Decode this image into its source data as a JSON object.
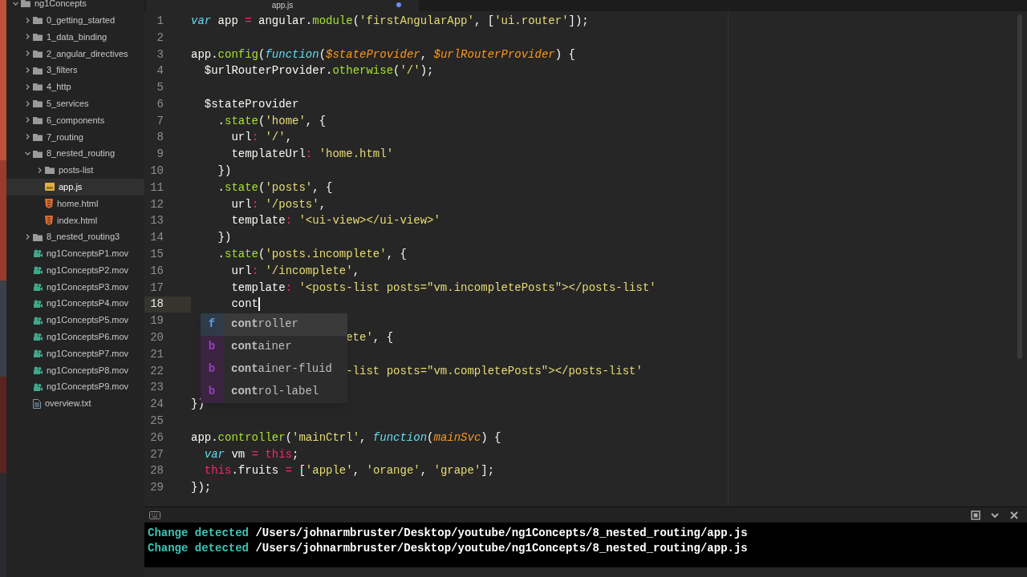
{
  "sidebar": {
    "tree": [
      {
        "label": "ng1Concepts",
        "kind": "folder",
        "expanded": true,
        "selected": false,
        "children": [
          {
            "label": "0_getting_started",
            "kind": "folder",
            "expanded": false,
            "selected": false
          },
          {
            "label": "1_data_binding",
            "kind": "folder",
            "expanded": false,
            "selected": false
          },
          {
            "label": "2_angular_directives",
            "kind": "folder",
            "expanded": false,
            "selected": false
          },
          {
            "label": "3_filters",
            "kind": "folder",
            "expanded": false,
            "selected": false
          },
          {
            "label": "4_http",
            "kind": "folder",
            "expanded": false,
            "selected": false
          },
          {
            "label": "5_services",
            "kind": "folder",
            "expanded": false,
            "selected": false
          },
          {
            "label": "6_components",
            "kind": "folder",
            "expanded": false,
            "selected": false
          },
          {
            "label": "7_routing",
            "kind": "folder",
            "expanded": false,
            "selected": false
          },
          {
            "label": "8_nested_routing",
            "kind": "folder",
            "expanded": true,
            "selected": false,
            "children": [
              {
                "label": "posts-list",
                "kind": "folder",
                "expanded": false,
                "selected": false
              },
              {
                "label": "app.js",
                "kind": "js",
                "selected": true
              },
              {
                "label": "home.html",
                "kind": "html",
                "selected": false
              },
              {
                "label": "index.html",
                "kind": "html",
                "selected": false
              }
            ]
          },
          {
            "label": "8_nested_routing3",
            "kind": "folder",
            "expanded": false,
            "selected": false
          },
          {
            "label": "ng1ConceptsP1.mov",
            "kind": "video",
            "selected": false
          },
          {
            "label": "ng1ConceptsP2.mov",
            "kind": "video",
            "selected": false
          },
          {
            "label": "ng1ConceptsP3.mov",
            "kind": "video",
            "selected": false
          },
          {
            "label": "ng1ConceptsP4.mov",
            "kind": "video",
            "selected": false
          },
          {
            "label": "ng1ConceptsP5.mov",
            "kind": "video",
            "selected": false
          },
          {
            "label": "ng1ConceptsP6.mov",
            "kind": "video",
            "selected": false
          },
          {
            "label": "ng1ConceptsP7.mov",
            "kind": "video",
            "selected": false
          },
          {
            "label": "ng1ConceptsP8.mov",
            "kind": "video",
            "selected": false
          },
          {
            "label": "ng1ConceptsP9.mov",
            "kind": "video",
            "selected": false
          },
          {
            "label": "overview.txt",
            "kind": "text",
            "selected": false
          }
        ]
      }
    ]
  },
  "tab": {
    "label": "app.js",
    "modified": true
  },
  "editor": {
    "lines": [
      {
        "number": "1",
        "tokens": [
          {
            "kind": "kw",
            "text": "var"
          },
          {
            "kind": "plain",
            "text": " app "
          },
          {
            "kind": "op",
            "text": "="
          },
          {
            "kind": "plain",
            "text": " angular."
          },
          {
            "kind": "fn",
            "text": "module"
          },
          {
            "kind": "plain",
            "text": "("
          },
          {
            "kind": "str",
            "text": "'firstAngularApp'"
          },
          {
            "kind": "plain",
            "text": ", ["
          },
          {
            "kind": "str",
            "text": "'ui.router'"
          },
          {
            "kind": "plain",
            "text": "]);"
          }
        ]
      },
      {
        "number": "2"
      },
      {
        "number": "3",
        "tokens": [
          {
            "kind": "plain",
            "text": "app."
          },
          {
            "kind": "fn",
            "text": "config"
          },
          {
            "kind": "plain",
            "text": "("
          },
          {
            "kind": "kw",
            "text": "function"
          },
          {
            "kind": "plain",
            "text": "("
          },
          {
            "kind": "param",
            "text": "$stateProvider"
          },
          {
            "kind": "plain",
            "text": ", "
          },
          {
            "kind": "param",
            "text": "$urlRouterProvider"
          },
          {
            "kind": "plain",
            "text": ") {"
          }
        ]
      },
      {
        "number": "4",
        "tokens": [
          {
            "kind": "plain",
            "text": "  $urlRouterProvider."
          },
          {
            "kind": "fn",
            "text": "otherwise"
          },
          {
            "kind": "plain",
            "text": "("
          },
          {
            "kind": "str",
            "text": "'/'"
          },
          {
            "kind": "plain",
            "text": ");"
          }
        ]
      },
      {
        "number": "5"
      },
      {
        "number": "6",
        "tokens": [
          {
            "kind": "plain",
            "text": "  $stateProvider"
          }
        ]
      },
      {
        "number": "7",
        "tokens": [
          {
            "kind": "plain",
            "text": "    ."
          },
          {
            "kind": "fn",
            "text": "state"
          },
          {
            "kind": "plain",
            "text": "("
          },
          {
            "kind": "str",
            "text": "'home'"
          },
          {
            "kind": "plain",
            "text": ", {"
          }
        ]
      },
      {
        "number": "8",
        "tokens": [
          {
            "kind": "plain",
            "text": "      url"
          },
          {
            "kind": "op",
            "text": ": "
          },
          {
            "kind": "str",
            "text": "'/'"
          },
          {
            "kind": "plain",
            "text": ","
          }
        ]
      },
      {
        "number": "9",
        "tokens": [
          {
            "kind": "plain",
            "text": "      templateUrl"
          },
          {
            "kind": "op",
            "text": ": "
          },
          {
            "kind": "str",
            "text": "'home.html'"
          }
        ]
      },
      {
        "number": "10",
        "tokens": [
          {
            "kind": "plain",
            "text": "    })"
          }
        ]
      },
      {
        "number": "11",
        "tokens": [
          {
            "kind": "plain",
            "text": "    ."
          },
          {
            "kind": "fn",
            "text": "state"
          },
          {
            "kind": "plain",
            "text": "("
          },
          {
            "kind": "str",
            "text": "'posts'"
          },
          {
            "kind": "plain",
            "text": ", {"
          }
        ]
      },
      {
        "number": "12",
        "tokens": [
          {
            "kind": "plain",
            "text": "      url"
          },
          {
            "kind": "op",
            "text": ": "
          },
          {
            "kind": "str",
            "text": "'/posts'"
          },
          {
            "kind": "plain",
            "text": ","
          }
        ]
      },
      {
        "number": "13",
        "tokens": [
          {
            "kind": "plain",
            "text": "      template"
          },
          {
            "kind": "op",
            "text": ": "
          },
          {
            "kind": "str",
            "text": "'<ui-view></ui-view>'"
          }
        ]
      },
      {
        "number": "14",
        "tokens": [
          {
            "kind": "plain",
            "text": "    })"
          }
        ]
      },
      {
        "number": "15",
        "tokens": [
          {
            "kind": "plain",
            "text": "    ."
          },
          {
            "kind": "fn",
            "text": "state"
          },
          {
            "kind": "plain",
            "text": "("
          },
          {
            "kind": "str",
            "text": "'posts.incomplete'"
          },
          {
            "kind": "plain",
            "text": ", {"
          }
        ]
      },
      {
        "number": "16",
        "tokens": [
          {
            "kind": "plain",
            "text": "      url"
          },
          {
            "kind": "op",
            "text": ": "
          },
          {
            "kind": "str",
            "text": "'/incomplete'"
          },
          {
            "kind": "plain",
            "text": ","
          }
        ]
      },
      {
        "number": "17",
        "tokens": [
          {
            "kind": "plain",
            "text": "      template"
          },
          {
            "kind": "op",
            "text": ": "
          },
          {
            "kind": "str",
            "text": "'<posts-list posts=\"vm.incompletePosts\"></posts-list'"
          }
        ]
      },
      {
        "number": "18",
        "current": true,
        "tokens": [
          {
            "kind": "plain",
            "text": "      cont"
          }
        ]
      },
      {
        "number": "19"
      },
      {
        "number": "20",
        "under_popup": true,
        "tokens": [
          {
            "kind": "str",
            "text": "ete'"
          },
          {
            "kind": "plain",
            "text": ", {"
          }
        ]
      },
      {
        "number": "21"
      },
      {
        "number": "22",
        "under_popup": true,
        "tokens": [
          {
            "kind": "str",
            "text": "-list posts=\"vm.completePosts\"></posts-list'"
          }
        ]
      },
      {
        "number": "23"
      },
      {
        "number": "24",
        "tokens": [
          {
            "kind": "plain",
            "text": "})"
          }
        ]
      },
      {
        "number": "25"
      },
      {
        "number": "26",
        "tokens": [
          {
            "kind": "plain",
            "text": "app."
          },
          {
            "kind": "fn",
            "text": "controller"
          },
          {
            "kind": "plain",
            "text": "("
          },
          {
            "kind": "str",
            "text": "'mainCtrl'"
          },
          {
            "kind": "plain",
            "text": ", "
          },
          {
            "kind": "kw",
            "text": "function"
          },
          {
            "kind": "plain",
            "text": "("
          },
          {
            "kind": "param",
            "text": "mainSvc"
          },
          {
            "kind": "plain",
            "text": ") {"
          }
        ]
      },
      {
        "number": "27",
        "tokens": [
          {
            "kind": "kw",
            "text": "  var"
          },
          {
            "kind": "plain",
            "text": " vm "
          },
          {
            "kind": "op",
            "text": "= "
          },
          {
            "kind": "this",
            "text": "this"
          },
          {
            "kind": "plain",
            "text": ";"
          }
        ]
      },
      {
        "number": "28",
        "tokens": [
          {
            "kind": "this",
            "text": "  this"
          },
          {
            "kind": "plain",
            "text": ".fruits "
          },
          {
            "kind": "op",
            "text": "= "
          },
          {
            "kind": "plain",
            "text": "["
          },
          {
            "kind": "str",
            "text": "'apple'"
          },
          {
            "kind": "plain",
            "text": ", "
          },
          {
            "kind": "str",
            "text": "'orange'"
          },
          {
            "kind": "plain",
            "text": ", "
          },
          {
            "kind": "str",
            "text": "'grape'"
          },
          {
            "kind": "plain",
            "text": "];"
          }
        ]
      },
      {
        "number": "29",
        "tokens": [
          {
            "kind": "plain",
            "text": "});"
          }
        ]
      }
    ]
  },
  "autocomplete": {
    "items": [
      {
        "kind": "f",
        "badge": "f",
        "label": "**cont**roller",
        "selected": true
      },
      {
        "kind": "b",
        "badge": "b",
        "label": "**cont**ainer",
        "selected": false
      },
      {
        "kind": "b",
        "badge": "b",
        "label": "**cont**ainer-fluid",
        "selected": false
      },
      {
        "kind": "b",
        "badge": "b",
        "label": "**cont**rol-label",
        "selected": false
      }
    ]
  },
  "terminal": {
    "lines": [
      {
        "status": "Change detected",
        "path": "/Users/johnarmbruster/Desktop/youtube/ng1Concepts/8_nested_routing/app.js"
      },
      {
        "status": "Change detected",
        "path": "/Users/johnarmbruster/Desktop/youtube/ng1Concepts/8_nested_routing/app.js"
      }
    ]
  }
}
